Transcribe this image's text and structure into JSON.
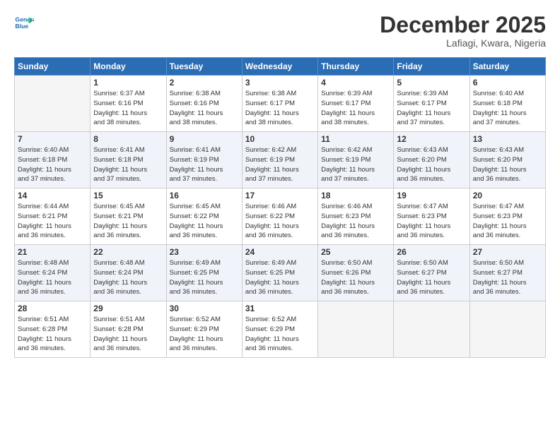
{
  "logo": {
    "line1": "General",
    "line2": "Blue"
  },
  "title": "December 2025",
  "location": "Lafiagi, Kwara, Nigeria",
  "weekdays": [
    "Sunday",
    "Monday",
    "Tuesday",
    "Wednesday",
    "Thursday",
    "Friday",
    "Saturday"
  ],
  "weeks": [
    [
      {
        "day": "",
        "empty": true
      },
      {
        "day": "1",
        "sunrise": "6:37 AM",
        "sunset": "6:16 PM",
        "daylight": "11 hours and 38 minutes."
      },
      {
        "day": "2",
        "sunrise": "6:38 AM",
        "sunset": "6:16 PM",
        "daylight": "11 hours and 38 minutes."
      },
      {
        "day": "3",
        "sunrise": "6:38 AM",
        "sunset": "6:17 PM",
        "daylight": "11 hours and 38 minutes."
      },
      {
        "day": "4",
        "sunrise": "6:39 AM",
        "sunset": "6:17 PM",
        "daylight": "11 hours and 38 minutes."
      },
      {
        "day": "5",
        "sunrise": "6:39 AM",
        "sunset": "6:17 PM",
        "daylight": "11 hours and 37 minutes."
      },
      {
        "day": "6",
        "sunrise": "6:40 AM",
        "sunset": "6:18 PM",
        "daylight": "11 hours and 37 minutes."
      }
    ],
    [
      {
        "day": "7",
        "sunrise": "6:40 AM",
        "sunset": "6:18 PM",
        "daylight": "11 hours and 37 minutes."
      },
      {
        "day": "8",
        "sunrise": "6:41 AM",
        "sunset": "6:18 PM",
        "daylight": "11 hours and 37 minutes."
      },
      {
        "day": "9",
        "sunrise": "6:41 AM",
        "sunset": "6:19 PM",
        "daylight": "11 hours and 37 minutes."
      },
      {
        "day": "10",
        "sunrise": "6:42 AM",
        "sunset": "6:19 PM",
        "daylight": "11 hours and 37 minutes."
      },
      {
        "day": "11",
        "sunrise": "6:42 AM",
        "sunset": "6:19 PM",
        "daylight": "11 hours and 37 minutes."
      },
      {
        "day": "12",
        "sunrise": "6:43 AM",
        "sunset": "6:20 PM",
        "daylight": "11 hours and 36 minutes."
      },
      {
        "day": "13",
        "sunrise": "6:43 AM",
        "sunset": "6:20 PM",
        "daylight": "11 hours and 36 minutes."
      }
    ],
    [
      {
        "day": "14",
        "sunrise": "6:44 AM",
        "sunset": "6:21 PM",
        "daylight": "11 hours and 36 minutes."
      },
      {
        "day": "15",
        "sunrise": "6:45 AM",
        "sunset": "6:21 PM",
        "daylight": "11 hours and 36 minutes."
      },
      {
        "day": "16",
        "sunrise": "6:45 AM",
        "sunset": "6:22 PM",
        "daylight": "11 hours and 36 minutes."
      },
      {
        "day": "17",
        "sunrise": "6:46 AM",
        "sunset": "6:22 PM",
        "daylight": "11 hours and 36 minutes."
      },
      {
        "day": "18",
        "sunrise": "6:46 AM",
        "sunset": "6:23 PM",
        "daylight": "11 hours and 36 minutes."
      },
      {
        "day": "19",
        "sunrise": "6:47 AM",
        "sunset": "6:23 PM",
        "daylight": "11 hours and 36 minutes."
      },
      {
        "day": "20",
        "sunrise": "6:47 AM",
        "sunset": "6:23 PM",
        "daylight": "11 hours and 36 minutes."
      }
    ],
    [
      {
        "day": "21",
        "sunrise": "6:48 AM",
        "sunset": "6:24 PM",
        "daylight": "11 hours and 36 minutes."
      },
      {
        "day": "22",
        "sunrise": "6:48 AM",
        "sunset": "6:24 PM",
        "daylight": "11 hours and 36 minutes."
      },
      {
        "day": "23",
        "sunrise": "6:49 AM",
        "sunset": "6:25 PM",
        "daylight": "11 hours and 36 minutes."
      },
      {
        "day": "24",
        "sunrise": "6:49 AM",
        "sunset": "6:25 PM",
        "daylight": "11 hours and 36 minutes."
      },
      {
        "day": "25",
        "sunrise": "6:50 AM",
        "sunset": "6:26 PM",
        "daylight": "11 hours and 36 minutes."
      },
      {
        "day": "26",
        "sunrise": "6:50 AM",
        "sunset": "6:27 PM",
        "daylight": "11 hours and 36 minutes."
      },
      {
        "day": "27",
        "sunrise": "6:50 AM",
        "sunset": "6:27 PM",
        "daylight": "11 hours and 36 minutes."
      }
    ],
    [
      {
        "day": "28",
        "sunrise": "6:51 AM",
        "sunset": "6:28 PM",
        "daylight": "11 hours and 36 minutes."
      },
      {
        "day": "29",
        "sunrise": "6:51 AM",
        "sunset": "6:28 PM",
        "daylight": "11 hours and 36 minutes."
      },
      {
        "day": "30",
        "sunrise": "6:52 AM",
        "sunset": "6:29 PM",
        "daylight": "11 hours and 36 minutes."
      },
      {
        "day": "31",
        "sunrise": "6:52 AM",
        "sunset": "6:29 PM",
        "daylight": "11 hours and 36 minutes."
      },
      {
        "day": "",
        "empty": true
      },
      {
        "day": "",
        "empty": true
      },
      {
        "day": "",
        "empty": true
      }
    ]
  ]
}
